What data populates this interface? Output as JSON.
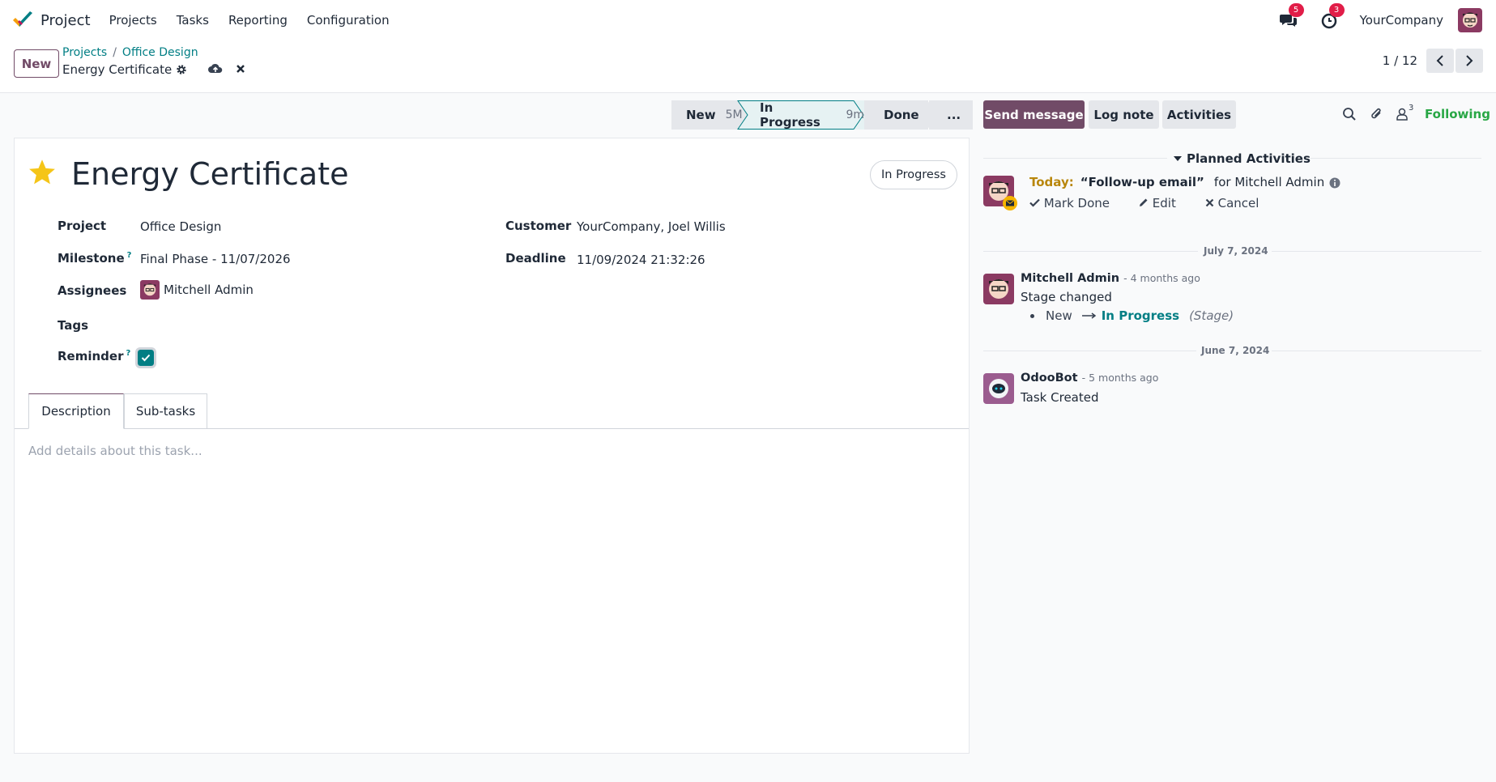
{
  "navbar": {
    "app_name": "Project",
    "menu": [
      "Projects",
      "Tasks",
      "Reporting",
      "Configuration"
    ],
    "messages_badge": "5",
    "activities_badge": "3",
    "company": "YourCompany"
  },
  "control_panel": {
    "new_label": "New",
    "breadcrumb": [
      "Projects",
      "Office Design"
    ],
    "record_name": "Energy Certificate",
    "pager": "1 / 12"
  },
  "statusbar": {
    "stages": [
      {
        "label": "New",
        "duration": "5M"
      },
      {
        "label": "In Progress",
        "duration": "9m"
      },
      {
        "label": "Done",
        "duration": ""
      },
      {
        "label": "...",
        "duration": ""
      }
    ],
    "active_stage": "In Progress"
  },
  "form": {
    "title": "Energy Certificate",
    "status": "In Progress",
    "fields": {
      "project_label": "Project",
      "project_value": "Office Design",
      "milestone_label": "Milestone",
      "milestone_value": "Final Phase - 11/07/2026",
      "assignees_label": "Assignees",
      "assignee": "Mitchell Admin",
      "tags_label": "Tags",
      "reminder_label": "Reminder",
      "customer_label": "Customer",
      "customer_value": "YourCompany, Joel Willis",
      "deadline_label": "Deadline",
      "deadline_value": "11/09/2024 21:32:26",
      "help_mark": "?"
    },
    "tabs": [
      "Description",
      "Sub-tasks"
    ],
    "description_placeholder": "Add details about this task..."
  },
  "chatter": {
    "send_message": "Send message",
    "log_note": "Log note",
    "activities": "Activities",
    "followers_count": "3",
    "following": "Following",
    "planned_header": "Planned Activities",
    "activity": {
      "today": "Today:",
      "summary": "“Follow-up email”",
      "for": "for Mitchell Admin",
      "mark_done": "Mark Done",
      "edit": "Edit",
      "cancel": "Cancel"
    },
    "date1": "July 7, 2024",
    "msg1": {
      "author": "Mitchell Admin",
      "time": "- 4 months ago",
      "body": "Stage changed",
      "old_value": "New",
      "new_value": "In Progress",
      "field": "(Stage)"
    },
    "date2": "June 7, 2024",
    "msg2": {
      "author": "OdooBot",
      "time": "- 5 months ago",
      "body": "Task Created"
    }
  },
  "colors": {
    "brand": "#714b67",
    "link": "#017e84",
    "following": "#28a745",
    "badge": "#e11d48",
    "star": "#f5c518"
  }
}
